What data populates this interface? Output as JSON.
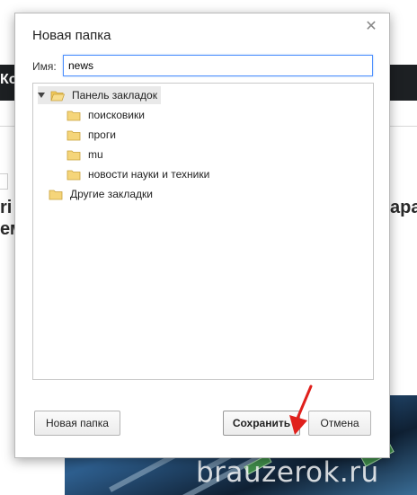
{
  "background": {
    "topbar_text": "Ко",
    "left_text_line1": "ri",
    "left_text_line2": "ем",
    "right_text": "ара",
    "watermark": "brauzerok.ru"
  },
  "dialog": {
    "title": "Новая папка",
    "close_icon": "close-icon",
    "name_label": "Имя:",
    "name_value": "news",
    "tree": {
      "root": {
        "label": "Панель закладок",
        "expanded": true,
        "selected": true
      },
      "children": [
        {
          "label": "поисковики"
        },
        {
          "label": "проги"
        },
        {
          "label": "mu"
        },
        {
          "label": "новости науки и техники"
        }
      ],
      "other": {
        "label": "Другие закладки"
      }
    },
    "buttons": {
      "new_folder": "Новая папка",
      "save": "Сохранить",
      "cancel": "Отмена"
    }
  },
  "colors": {
    "folder_fill": "#f5d57a",
    "folder_stroke": "#c9a13a",
    "input_focus": "#4d90fe",
    "pointer_arrow": "#e0201c"
  }
}
